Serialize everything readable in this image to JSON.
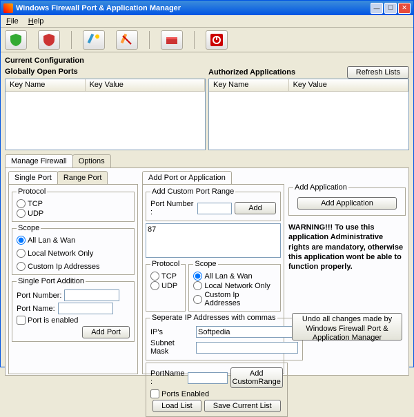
{
  "window": {
    "title": "Windows Firewall Port & Application Manager"
  },
  "menu": {
    "file": "File",
    "help": "Help"
  },
  "section": {
    "current_cfg": "Current Configuration",
    "globally_open": "Globally Open Ports",
    "authorized_apps": "Authorized Applications",
    "refresh": "Refresh Lists",
    "key_name": "Key Name",
    "key_value": "Key Value"
  },
  "tabs": {
    "manage": "Manage Firewall",
    "options": "Options",
    "single_port": "Single Port",
    "range_port": "Range Port"
  },
  "left": {
    "protocol": "Protocol",
    "tcp": "TCP",
    "udp": "UDP",
    "scope": "Scope",
    "all_lan_wan": "All Lan & Wan",
    "local_net": "Local Network Only",
    "custom_ip": "Custom Ip Addresses",
    "single_port_add": "Single Port Addition",
    "port_number": "Port Number:",
    "port_name": "Port Name:",
    "port_enabled": "Port is enabled",
    "add_port": "Add Port"
  },
  "mid": {
    "add_port_app": "Add Port or Application",
    "add_custom_range": "Add Custom Port Range",
    "port_number": "Port Number :",
    "add": "Add",
    "range_value": "87",
    "protocol": "Protocol",
    "tcp": "TCP",
    "udp": "UDP",
    "scope": "Scope",
    "all_lan_wan": "All Lan & Wan",
    "local_net": "Local Network Only",
    "custom_ip": "Custom Ip Addresses",
    "sep_ip": "Seperate IP Addresses with commas",
    "ips": "IP's",
    "ips_val": "Softpedia",
    "subnet": "Subnet Mask",
    "portname": "PortName :",
    "ports_enabled": "Ports Enabled",
    "add_custom_range_btn": "Add CustomRange",
    "load_list": "Load List",
    "save_list": "Save Current List"
  },
  "right": {
    "add_app_hdr": "Add Application",
    "add_app_btn": "Add Application",
    "warning": "WARNING!!! To use this application Administrative rights are mandatory, otherwise this application wont be able to function properly.",
    "undo": "Undo all changes made by Windows Firewall Port & Application Manager"
  }
}
